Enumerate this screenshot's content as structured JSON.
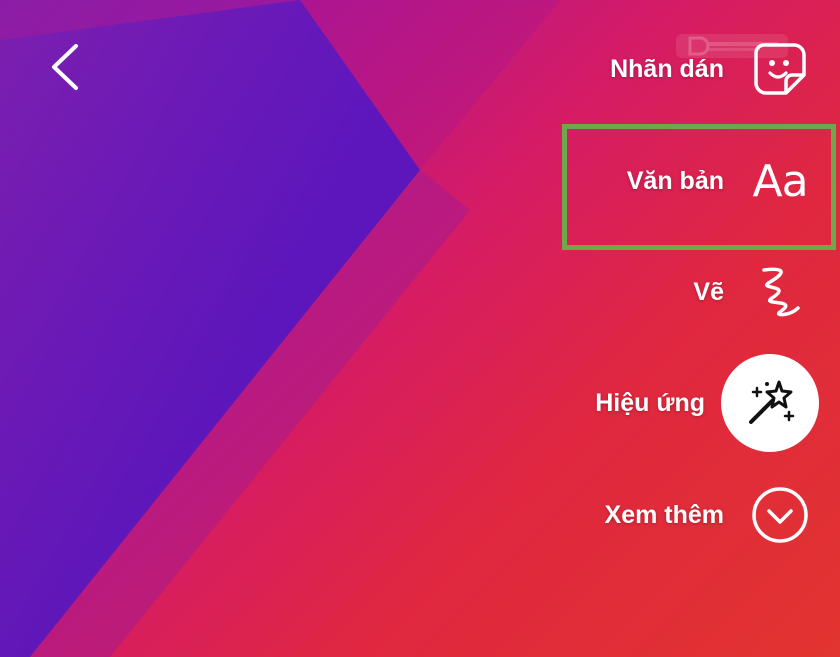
{
  "screen": {
    "background_colors": [
      "#8a1fa6",
      "#d51b66",
      "#e23430"
    ],
    "accent_highlight": "#6ea84c"
  },
  "header": {
    "back_icon": "chevron-left-icon",
    "watermark_icon": "dlztech-logo"
  },
  "menu": {
    "items": [
      {
        "label": "Nhãn dán",
        "icon": "sticker-icon"
      },
      {
        "label": "Văn bản",
        "icon": "text-aa-icon",
        "glyph": "Aa"
      },
      {
        "label": "Vẽ",
        "icon": "draw-squiggle-icon"
      },
      {
        "label": "Hiệu ứng",
        "icon": "magic-wand-icon"
      },
      {
        "label": "Xem thêm",
        "icon": "chevron-down-circle-icon"
      }
    ]
  }
}
